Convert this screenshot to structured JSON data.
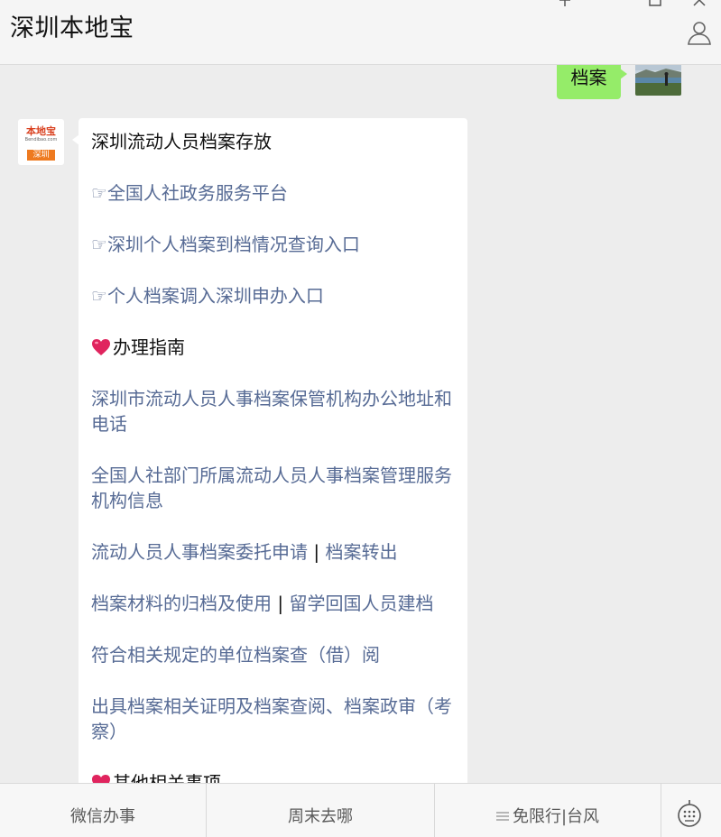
{
  "header": {
    "title": "深圳本地宝",
    "window_controls": [
      "minimize-icon",
      "maximize-icon",
      "close-icon"
    ],
    "profile_icon": "person-icon"
  },
  "chat": {
    "self_message": {
      "text": "档案",
      "bubble_color": "#95ec69"
    },
    "bot_avatar": {
      "logo_main": "本地宝",
      "logo_url": "Bendibao.com",
      "logo_city": "深圳"
    },
    "bot_message": {
      "title": "深圳流动人员档案存放",
      "pointer": "☞",
      "links": [
        "全国人社政务服务平台",
        "深圳个人档案到档情况查询入口",
        "个人档案调入深圳申办入口"
      ],
      "guide_heading": "办理指南",
      "guide_links": [
        "深圳市流动人员人事档案保管机构办公地址和电话",
        "全国人社部门所属流动人员人事档案管理服务机构信息"
      ],
      "pair_links": [
        {
          "a": "流动人员人事档案委托申请",
          "b": "档案转出"
        },
        {
          "a": "档案材料的归档及使用",
          "b": "留学回国人员建档"
        }
      ],
      "separator": "|",
      "more_links": [
        "符合相关规定的单位档案查（借）阅",
        "出具档案相关证明及档案查阅、档案政审（考察）"
      ],
      "other_heading": "其他相关事项",
      "link_color": "#576b95",
      "heart_color": "#e0245e"
    }
  },
  "bottom_menu": {
    "items": [
      "微信办事",
      "周末去哪",
      "免限行|台风"
    ],
    "menu_icon": "menu-lines-icon",
    "keyboard_icon": "keyboard-icon"
  }
}
